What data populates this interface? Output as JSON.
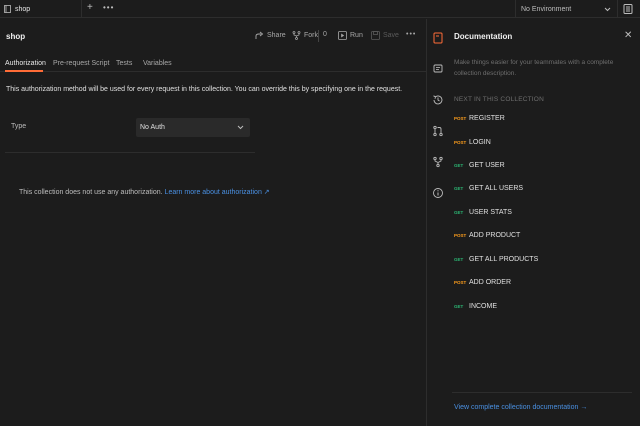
{
  "tabs": [
    {
      "label": "shop"
    }
  ],
  "environment": {
    "label": "No Environment"
  },
  "collection": {
    "title": "shop"
  },
  "actions": {
    "share": "Share",
    "fork": "Fork",
    "fork_count": "0",
    "run": "Run",
    "save": "Save"
  },
  "subtabs": [
    "Authorization",
    "Pre-request Script",
    "Tests",
    "Variables"
  ],
  "auth": {
    "description": "This authorization method will be used for every request in this collection. You can override this by specifying one in the request.",
    "type_label": "Type",
    "type_value": "No Auth",
    "info_text": "This collection does not use any authorization.",
    "info_link": "Learn more about authorization ↗"
  },
  "docs": {
    "title": "Documentation",
    "description": "Make things easier for your teammates with a complete collection description.",
    "next_heading": "NEXT IN THIS COLLECTION",
    "requests": [
      {
        "method": "POST",
        "name": "REGISTER"
      },
      {
        "method": "POST",
        "name": "LOGIN"
      },
      {
        "method": "GET",
        "name": "GET USER"
      },
      {
        "method": "GET",
        "name": "GET ALL USERS"
      },
      {
        "method": "GET",
        "name": "USER STATS"
      },
      {
        "method": "POST",
        "name": "ADD PRODUCT"
      },
      {
        "method": "GET",
        "name": "GET ALL PRODUCTS"
      },
      {
        "method": "POST",
        "name": "ADD ORDER"
      },
      {
        "method": "GET",
        "name": "INCOME"
      }
    ],
    "view_all": "View complete collection documentation →"
  },
  "colors": {
    "accent": "#ff6c37",
    "post": "#ff9f1c",
    "get": "#2bb673",
    "link": "#4a90e2"
  }
}
